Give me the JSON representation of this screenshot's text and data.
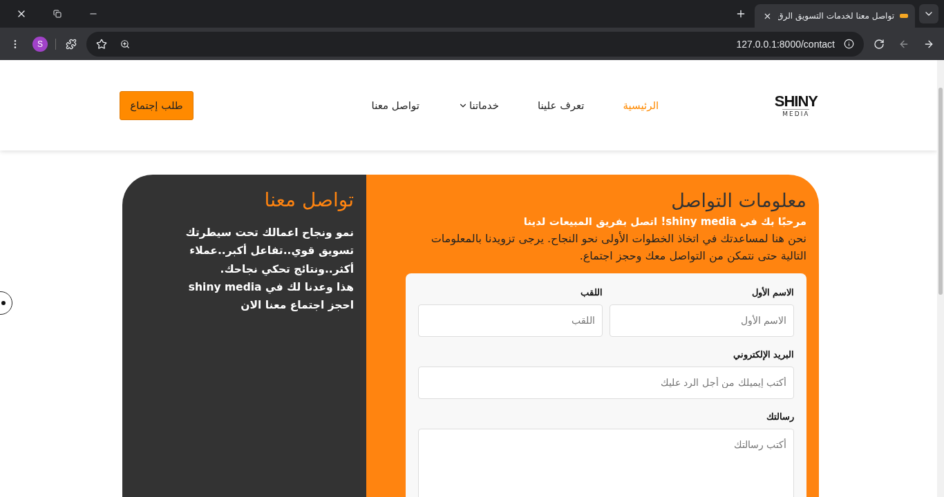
{
  "browser": {
    "tab": {
      "title": "تواصل معنا لخدمات التسويق الرق"
    },
    "url": "127.0.0.1:8000/contact",
    "profile": "S"
  },
  "header": {
    "logo": {
      "name": "SHINY",
      "tagline": "MEDIA"
    },
    "links": [
      {
        "label": "الرئيسية",
        "selected": true,
        "dropdown": false
      },
      {
        "label": "تعرف علينا",
        "selected": false,
        "dropdown": false
      },
      {
        "label": "خدماتنا",
        "selected": false,
        "dropdown": true
      },
      {
        "label": "تواصل معنا",
        "selected": false,
        "dropdown": false
      }
    ],
    "cta": "طلب إجتماع"
  },
  "contact": {
    "info": {
      "title": "معلومات التواصل",
      "welcome": "مرحبًا بك في shiny media! اتصل بفريق المبيعات لدينا",
      "text": "نحن هنا لمساعدتك في اتخاذ الخطوات الأولى نحو النجاح. يرجى تزويدنا بالمعلومات التالية حتى نتمكن من التواصل معك وحجز اجتماع."
    },
    "form": {
      "rows": [
        [
          {
            "label": "الاسم الأول",
            "placeholder": "الاسم الأول",
            "kind": "input"
          },
          {
            "label": "اللقب",
            "placeholder": "اللقب",
            "kind": "input"
          }
        ],
        [
          {
            "label": "البريد الإلكتروني",
            "placeholder": "أكتب إيميلك من أجل الرد عليك",
            "kind": "input"
          }
        ],
        [
          {
            "label": "رسالتك",
            "placeholder": "أكتب رسالتك",
            "kind": "textarea"
          }
        ]
      ]
    },
    "side": {
      "title": "تواصل معنا",
      "lines": [
        "نمو ونجاح اعمالك تحت سيطرتك",
        "تسويق قوي..تفاعل أكبر..عملاء أكثر..ونتائج تحكي نجاحك.",
        "هذا وعدنا لك في shiny media",
        "احجز اجتماع معنا الان"
      ]
    }
  }
}
